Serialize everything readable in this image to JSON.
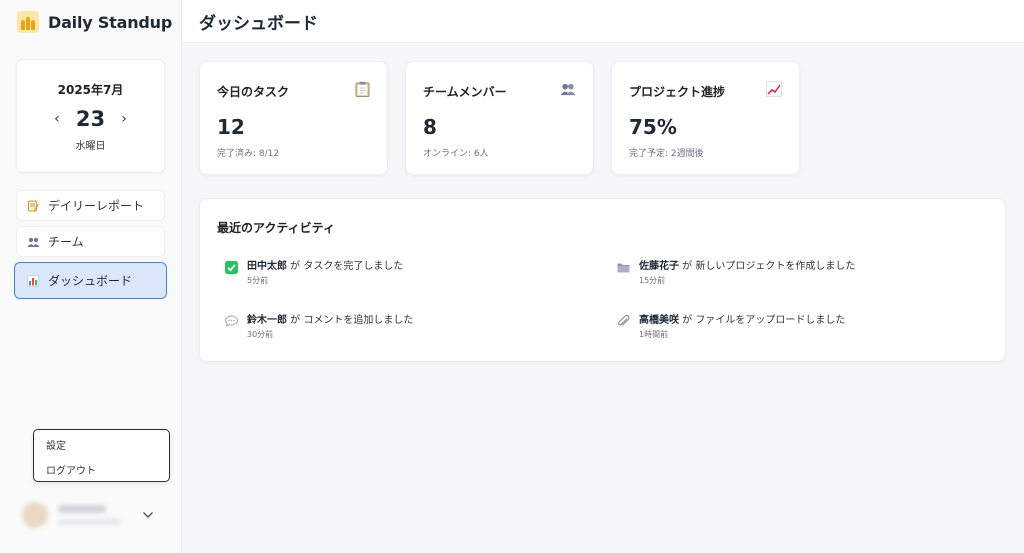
{
  "brand": {
    "name": "Daily Standup"
  },
  "date": {
    "month": "2025年7月",
    "day": "23",
    "weekday": "水曜日",
    "prev": "‹",
    "next": "›"
  },
  "nav": {
    "items": [
      {
        "label": "デイリーレポート",
        "icon": "memo-icon"
      },
      {
        "label": "チーム",
        "icon": "people-icon"
      },
      {
        "label": "ダッシュボード",
        "icon": "bar-chart-icon",
        "active": true
      }
    ]
  },
  "user_menu": {
    "settings": "設定",
    "logout": "ログアウト"
  },
  "header": {
    "title": "ダッシュボード"
  },
  "stats": [
    {
      "title": "今日のタスク",
      "value": "12",
      "sub": "完了済み: 8/12",
      "icon": "clipboard-icon"
    },
    {
      "title": "チームメンバー",
      "value": "8",
      "sub": "オンライン: 6人",
      "icon": "people-icon"
    },
    {
      "title": "プロジェクト進捗",
      "value": "75%",
      "sub": "完了予定: 2週間後",
      "icon": "chart-up-icon"
    }
  ],
  "activity": {
    "title": "最近のアクティビティ",
    "items": [
      {
        "user": "田中太郎",
        "text": " が タスクを完了しました",
        "time": "5分前",
        "icon": "check-icon"
      },
      {
        "user": "佐藤花子",
        "text": " が 新しいプロジェクトを作成しました",
        "time": "15分前",
        "icon": "folder-icon"
      },
      {
        "user": "鈴木一郎",
        "text": " が コメントを追加しました",
        "time": "30分前",
        "icon": "comment-icon"
      },
      {
        "user": "高橋美咲",
        "text": " が ファイルをアップロードしました",
        "time": "1時間前",
        "icon": "paperclip-icon"
      }
    ]
  },
  "colors": {
    "accent": "#3b82f6",
    "active_bg": "#dbe7fb"
  }
}
